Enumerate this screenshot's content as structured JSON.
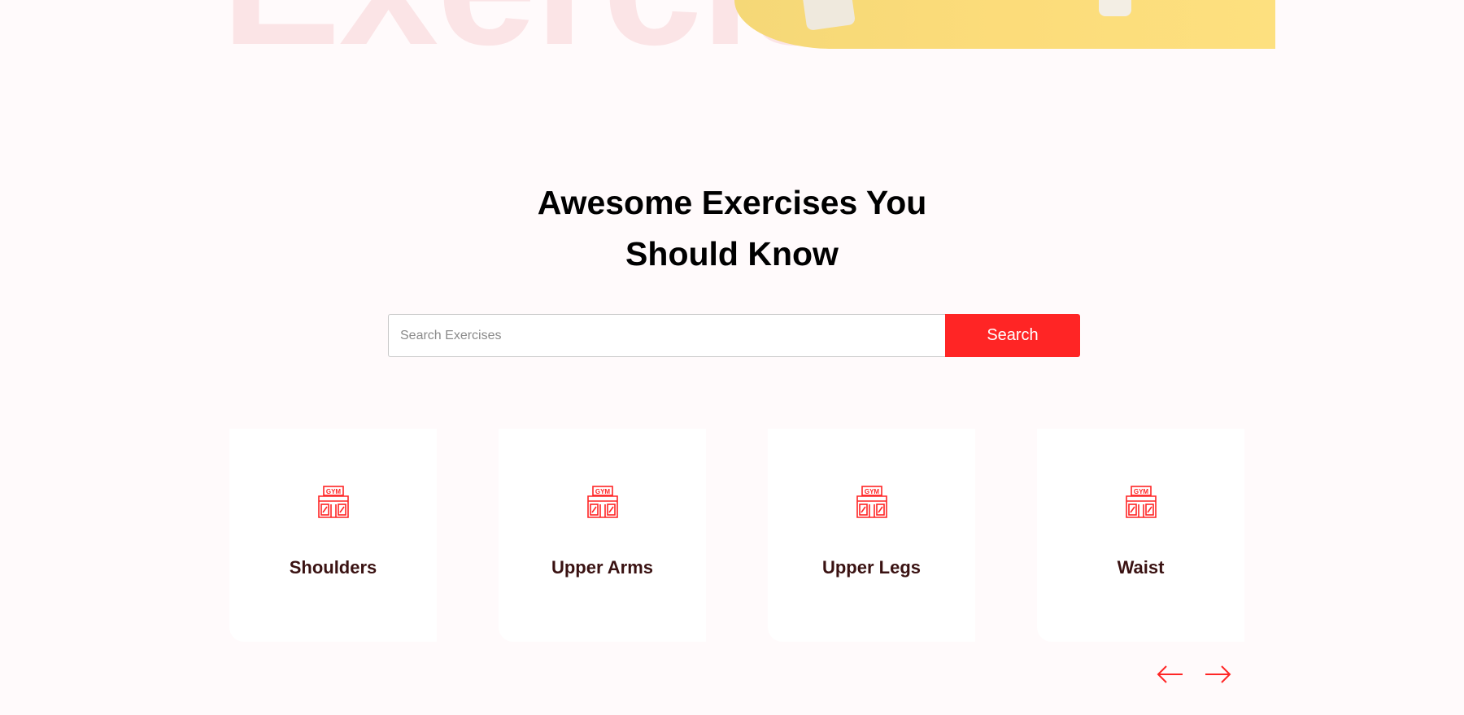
{
  "hero": {
    "background_text": "Exercise",
    "banner_color": "#fcdc7a"
  },
  "section": {
    "title_line1": "Awesome Exercises You",
    "title_line2": "Should Know"
  },
  "search": {
    "placeholder": "Search Exercises",
    "value": "",
    "button_label": "Search",
    "accent_color": "#ff2525"
  },
  "body_parts": [
    {
      "label": "Shoulders",
      "icon": "gym-icon"
    },
    {
      "label": "Upper Arms",
      "icon": "gym-icon"
    },
    {
      "label": "Upper Legs",
      "icon": "gym-icon"
    },
    {
      "label": "Waist",
      "icon": "gym-icon"
    }
  ],
  "carousel": {
    "prev_icon": "arrow-left-icon",
    "next_icon": "arrow-right-icon"
  }
}
